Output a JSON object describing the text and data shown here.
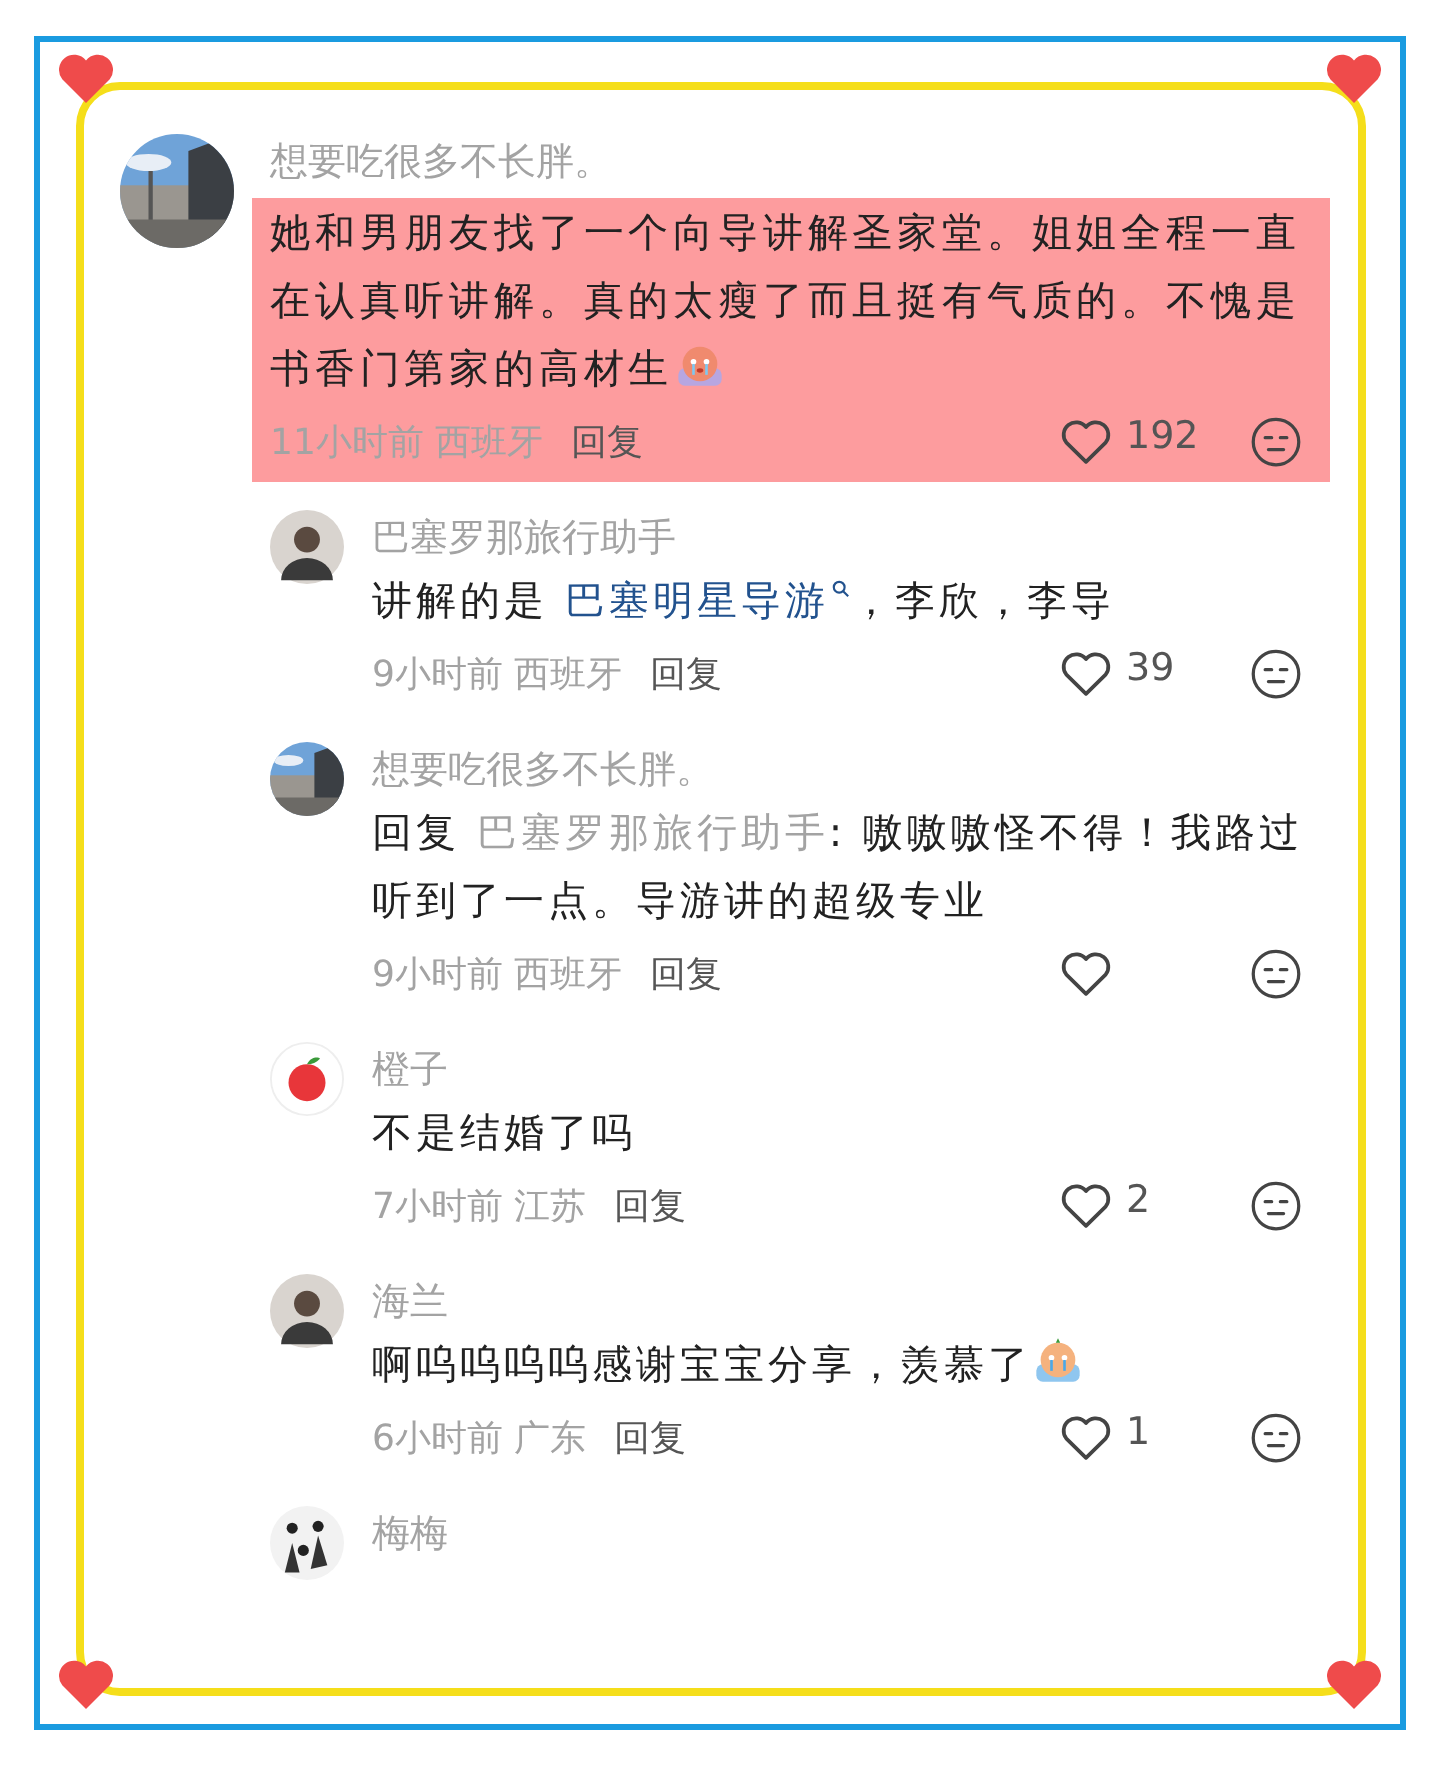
{
  "comments": [
    {
      "name": "想要吃很多不长胖。",
      "avatar": {
        "kind": "landscape"
      },
      "highlighted": true,
      "segments": [
        {
          "kind": "text",
          "text": "她和男朋友找了一个向导讲解圣家堂。姐姐全程一直在认真听讲解。真的太瘦了而且挺有气质的。不愧是书香门第家的高材生"
        },
        {
          "kind": "emoji"
        }
      ],
      "time": "11小时前",
      "location": "西班牙",
      "reply": "回复",
      "likes": "192",
      "replies": [
        {
          "name": "巴塞罗那旅行助手",
          "avatar": {
            "kind": "portrait"
          },
          "highlighted": false,
          "segments": [
            {
              "kind": "text",
              "text": "讲解的是 "
            },
            {
              "kind": "link",
              "text": "巴塞明星导游"
            },
            {
              "kind": "text",
              "text": "，李欣，李导"
            }
          ],
          "time": "9小时前",
          "location": "西班牙",
          "reply": "回复",
          "likes": "39"
        },
        {
          "name": "想要吃很多不长胖。",
          "avatar": {
            "kind": "landscape"
          },
          "highlighted": false,
          "segments": [
            {
              "kind": "text",
              "text": "回复 "
            },
            {
              "kind": "mention",
              "text": "巴塞罗那旅行助手"
            },
            {
              "kind": "text",
              "text": ": 嗷嗷嗷怪不得！我路过听到了一点。导游讲的超级专业"
            }
          ],
          "time": "9小时前",
          "location": "西班牙",
          "reply": "回复"
        },
        {
          "name": "橙子",
          "avatar": {
            "kind": "apple"
          },
          "highlighted": false,
          "segments": [
            {
              "kind": "text",
              "text": "不是结婚了吗"
            }
          ],
          "time": "7小时前",
          "location": "江苏",
          "reply": "回复",
          "likes": "2"
        },
        {
          "name": "海兰",
          "avatar": {
            "kind": "portrait"
          },
          "highlighted": false,
          "segments": [
            {
              "kind": "text",
              "text": "啊呜呜呜呜感谢宝宝分享，羡慕了"
            },
            {
              "kind": "emoji"
            }
          ],
          "time": "6小时前",
          "location": "广东",
          "reply": "回复",
          "likes": "1"
        },
        {
          "name": "梅梅",
          "avatar": {
            "kind": "group"
          }
        }
      ]
    }
  ]
}
